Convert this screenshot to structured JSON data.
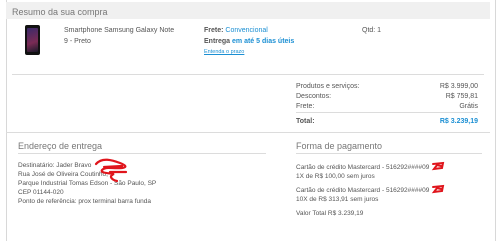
{
  "summary": {
    "title": "Resumo da sua compra",
    "product": {
      "name_line1": "Smartphone Samsung Galaxy Note",
      "name_line2": "9 - Preto",
      "shipping_label": "Frete:",
      "shipping_value": "Convencional",
      "delivery_label": "Entrega",
      "delivery_value": "em até 5 dias úteis",
      "deadline_link": "Entenda o prazo",
      "qty": "Qtd: 1"
    },
    "totals": {
      "products_label": "Produtos e serviços:",
      "products_value": "R$ 3.999,00",
      "discounts_label": "Descontos:",
      "discounts_value": "R$ 759,81",
      "shipping_label": "Frete:",
      "shipping_value": "Grátis",
      "total_label": "Total:",
      "total_value": "R$ 3.239,19"
    }
  },
  "delivery": {
    "title": "Endereço de entrega",
    "recipient": "Destinatário: Jader Bravo",
    "street": "Rua José de Oliveira Coutinho, 1",
    "district": "Parque Industrial Tomas Edson - São Paulo, SP",
    "zip": "CEP 01144-020",
    "reference": "Ponto de referência: prox terminal barra funda"
  },
  "payment": {
    "title": "Forma de pagamento",
    "card1": "Cartão de crédito Mastercard - 516292####09",
    "card1_installments": "1X de R$ 100,00 sem juros",
    "card2": "Cartão de crédito Mastercard - 516292####09",
    "card2_installments": "10X de R$ 313,91 sem juros",
    "total": "Valor Total R$ 3.239,19"
  },
  "colors": {
    "accent": "#1b8fd3",
    "redaction": "#e0151c"
  }
}
